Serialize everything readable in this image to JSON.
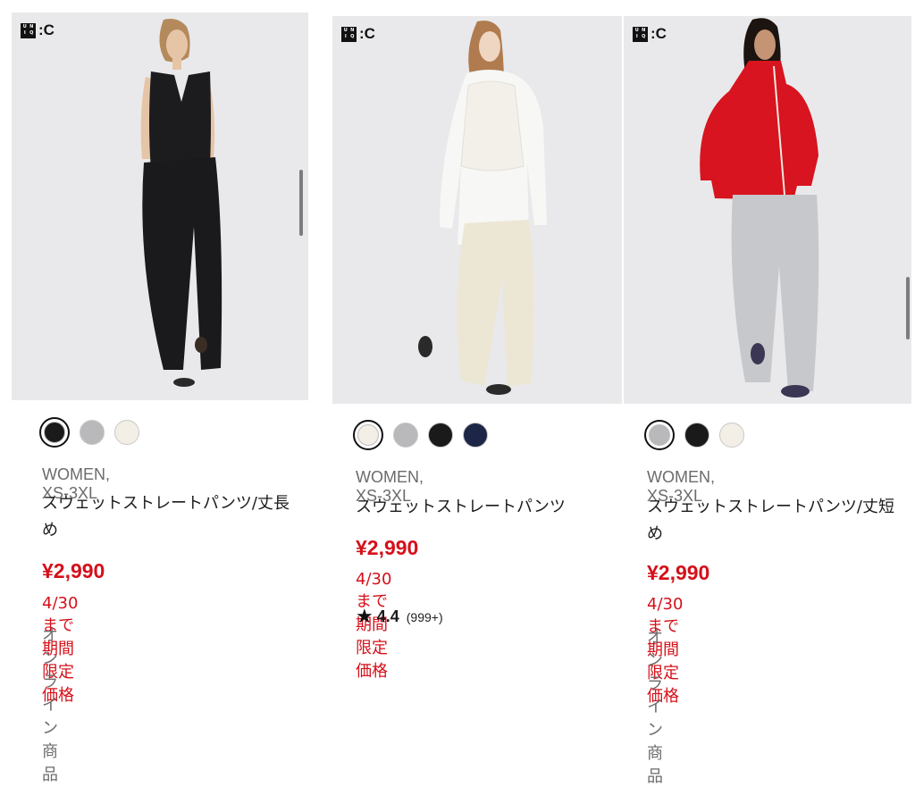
{
  "brand": {
    "logo_text": "C"
  },
  "products": [
    {
      "image_alt": "Model in black vest and wide black pants",
      "swatch_colors": [
        "#1a1a1a",
        "#b9b9bc",
        "#f3efe6"
      ],
      "selected_swatch": 0,
      "meta": "WOMEN, XS-3XL",
      "name": "スウェットストレートパンツ/丈長め",
      "price": "¥2,990",
      "promo": "4/30まで期間限定価格",
      "online": "オンライン商品"
    },
    {
      "image_alt": "Model in white shirt, cream vest and cream wide pants",
      "swatch_colors": [
        "#f3efe6",
        "#b9b9bc",
        "#1a1a1a",
        "#1d2646"
      ],
      "selected_swatch": 0,
      "meta": "WOMEN, XS-3XL",
      "name": "スウェットストレートパンツ",
      "price": "¥2,990",
      "promo": "4/30まで期間限定価格",
      "rating": {
        "score": "4.4",
        "count": "(999+)"
      }
    },
    {
      "image_alt": "Model in red zip jacket and grey wide pants",
      "swatch_colors": [
        "#b9b9bc",
        "#1a1a1a",
        "#f3efe6"
      ],
      "selected_swatch": 0,
      "meta": "WOMEN, XS-3XL",
      "name": "スウェットストレートパンツ/丈短め",
      "price": "¥2,990",
      "promo": "4/30まで期間限定価格",
      "online": "オンライン商品"
    }
  ]
}
